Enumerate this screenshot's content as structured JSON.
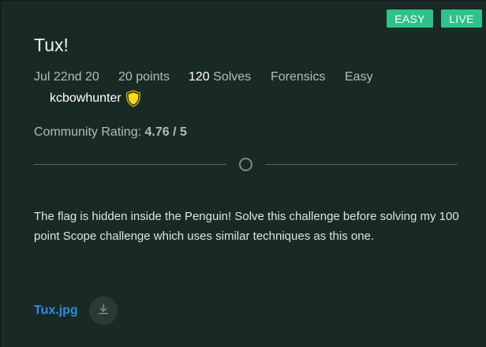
{
  "badges": {
    "difficulty": "EASY",
    "status": "LIVE"
  },
  "challenge": {
    "title": "Tux!",
    "date": "Jul 22nd 20",
    "points": "20 points",
    "solves_count": "120",
    "solves_label": " Solves",
    "category": "Forensics",
    "difficulty": "Easy",
    "author": "kcbowhunter",
    "author_badge_icon": "shield-icon"
  },
  "rating": {
    "label": "Community Rating: ",
    "value": "4.76 / 5"
  },
  "description": "The flag is hidden inside the Penguin! Solve this challenge before solving my 100 point Scope challenge which uses similar techniques as this one.",
  "attachment": {
    "filename": "Tux.jpg",
    "download_icon": "download-icon"
  },
  "colors": {
    "background": "#192a26",
    "accent_badge": "#2ec28a",
    "link": "#2f8bdc"
  }
}
